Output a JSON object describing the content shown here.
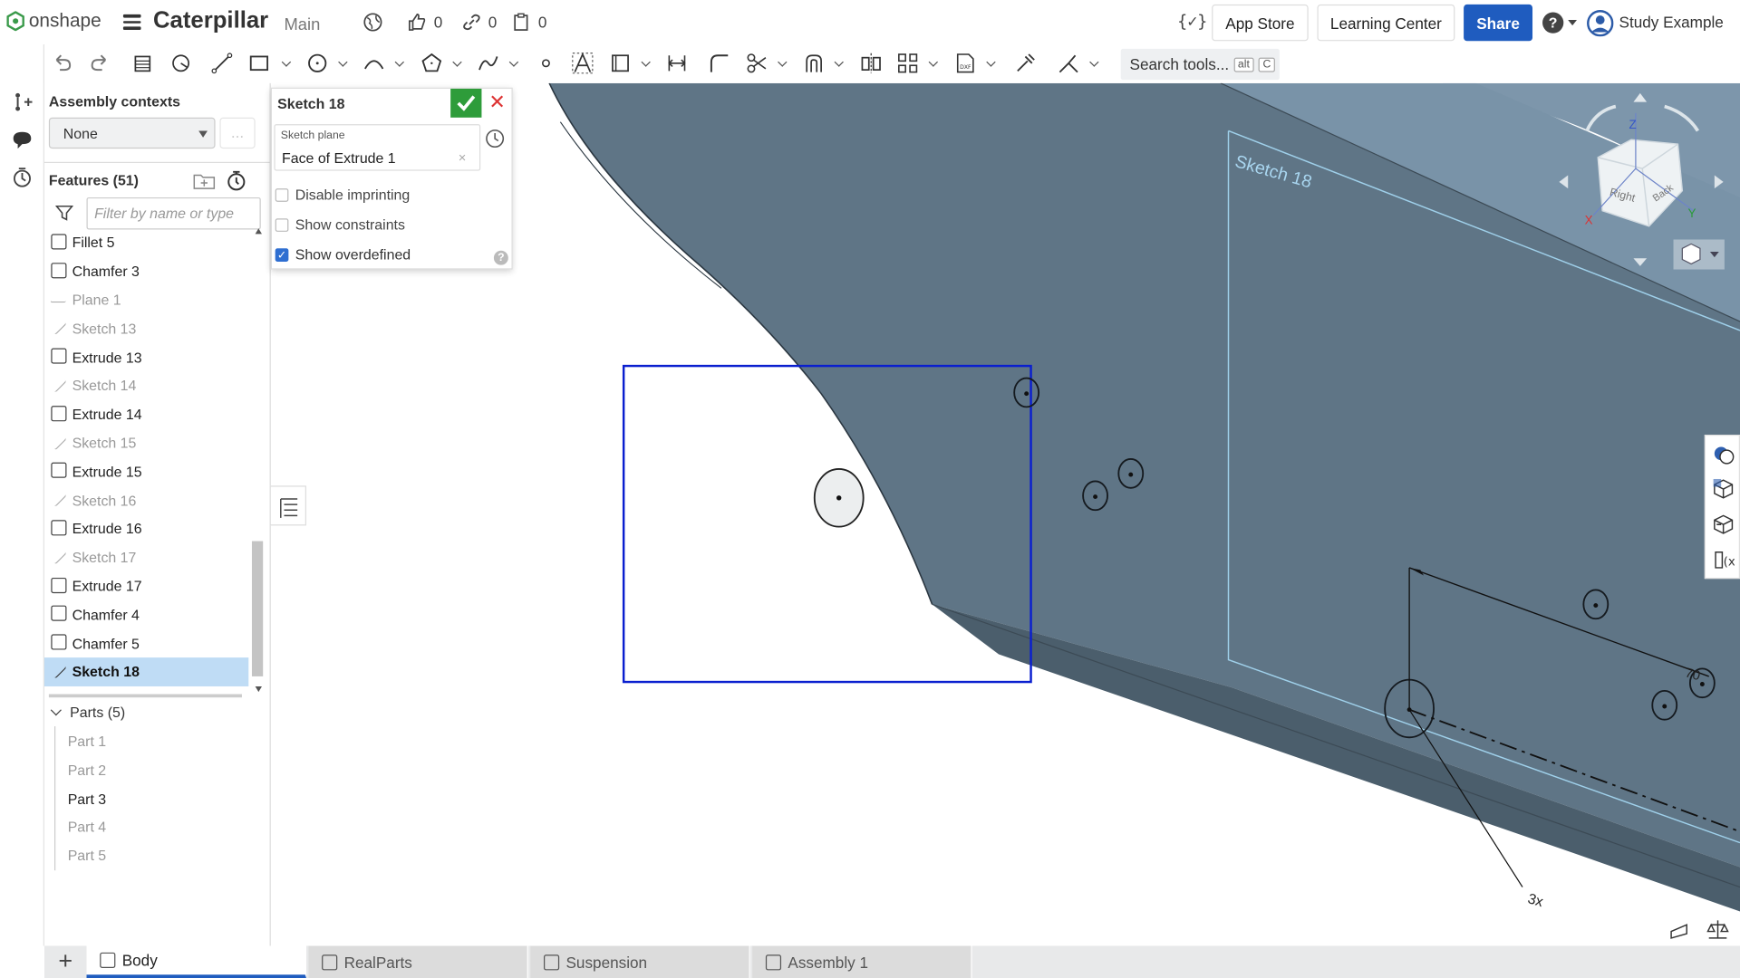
{
  "app": {
    "brand": "onshape",
    "title": "Caterpillar",
    "branch": "Main"
  },
  "counters": {
    "likes": "0",
    "links": "0",
    "copies": "0"
  },
  "header": {
    "app_store": "App Store",
    "learning_center": "Learning Center",
    "share": "Share",
    "user": "Study Example"
  },
  "toolbar": {
    "search_placeholder": "Search tools...",
    "kbd_alt": "alt",
    "kbd_c": "C"
  },
  "panel": {
    "assembly_contexts": "Assembly contexts",
    "context_value": "None",
    "context_more": "...",
    "features_title": "Features (51)",
    "filter_placeholder": "Filter by name or type",
    "features": [
      {
        "label": "Fillet 5",
        "kind": "feature"
      },
      {
        "label": "Chamfer 3",
        "kind": "feature"
      },
      {
        "label": "Plane 1",
        "kind": "plane"
      },
      {
        "label": "Sketch 13",
        "kind": "sketch"
      },
      {
        "label": "Extrude 13",
        "kind": "feature"
      },
      {
        "label": "Sketch 14",
        "kind": "sketch"
      },
      {
        "label": "Extrude 14",
        "kind": "feature"
      },
      {
        "label": "Sketch 15",
        "kind": "sketch"
      },
      {
        "label": "Extrude 15",
        "kind": "feature"
      },
      {
        "label": "Sketch 16",
        "kind": "sketch"
      },
      {
        "label": "Extrude 16",
        "kind": "feature"
      },
      {
        "label": "Sketch 17",
        "kind": "sketch"
      },
      {
        "label": "Extrude 17",
        "kind": "feature"
      },
      {
        "label": "Chamfer 4",
        "kind": "feature"
      },
      {
        "label": "Chamfer 5",
        "kind": "feature"
      },
      {
        "label": "Sketch 18",
        "kind": "selected"
      }
    ],
    "parts_title": "Parts (5)",
    "parts": [
      {
        "label": "Part 1",
        "active": false
      },
      {
        "label": "Part 2",
        "active": false
      },
      {
        "label": "Part 3",
        "active": true
      },
      {
        "label": "Part 4",
        "active": false
      },
      {
        "label": "Part 5",
        "active": false
      }
    ]
  },
  "dialog": {
    "title": "Sketch 18",
    "plane_label": "Sketch plane",
    "plane_value": "Face of Extrude 1",
    "disable_imprinting": "Disable imprinting",
    "show_constraints": "Show constraints",
    "show_overdefined": "Show overdefined",
    "overdefined_checked": true
  },
  "viewport": {
    "sketch_label": "Sketch 18",
    "dim_3x": "3x",
    "dim_partial": "70",
    "cube_z": "Z",
    "cube_right": "Right",
    "cube_back": "Back",
    "cube_x": "X",
    "cube_y": "Y",
    "accent_blue": "#0a1fcf",
    "body_color": "#5f7586"
  },
  "tabs": [
    {
      "label": "Body",
      "active": true
    },
    {
      "label": "RealParts",
      "active": false
    },
    {
      "label": "Suspension",
      "active": false
    },
    {
      "label": "Assembly 1",
      "active": false
    }
  ]
}
